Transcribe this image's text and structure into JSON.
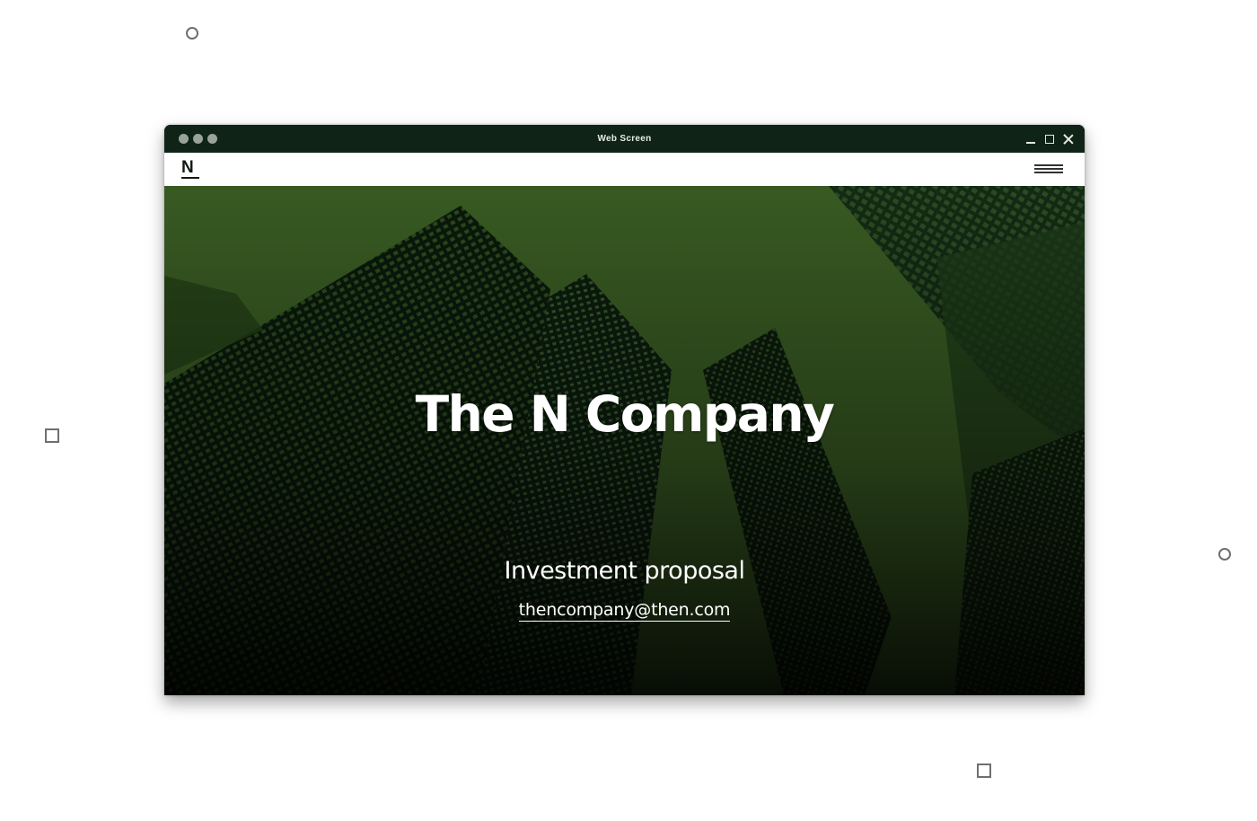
{
  "window": {
    "title": "Web Screen"
  },
  "navbar": {
    "logo_letter": "N"
  },
  "hero": {
    "title": "The N Company",
    "subtitle": "Investment proposal",
    "email": "thencompany@then.com"
  },
  "colors": {
    "titlebar": "#0f2416",
    "accent_green": "#385a22",
    "dark_building": "#07150a",
    "text_light": "#ffffff"
  }
}
